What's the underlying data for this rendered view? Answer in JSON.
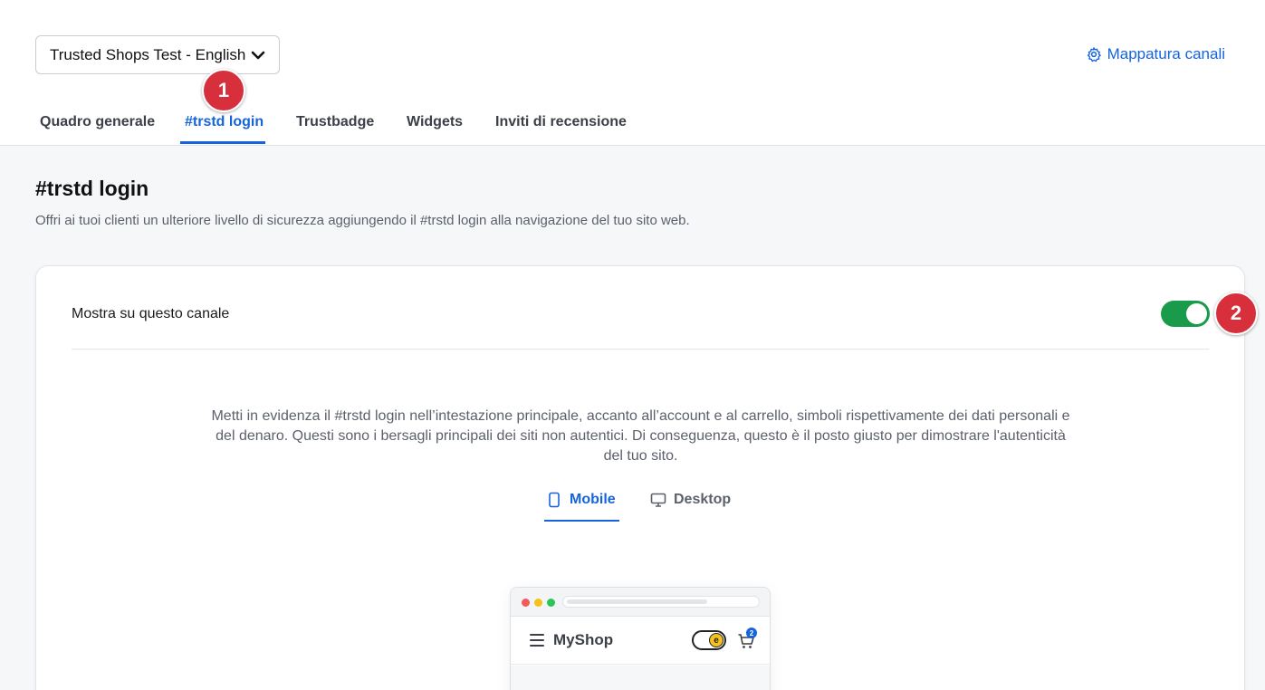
{
  "header": {
    "channel_select": "Trusted Shops Test - English",
    "mapping_link": "Mappatura canali"
  },
  "tabs": [
    {
      "label": "Quadro generale"
    },
    {
      "label": "#trstd login"
    },
    {
      "label": "Trustbadge"
    },
    {
      "label": "Widgets"
    },
    {
      "label": "Inviti di recensione"
    }
  ],
  "active_tab": "#trstd login",
  "badges": {
    "one": "1",
    "two": "2"
  },
  "page": {
    "title": "#trstd login",
    "subtitle": "Offri ai tuoi clienti un ulteriore livello di sicurezza aggiungendo il #trstd login alla navigazione del tuo sito web."
  },
  "card": {
    "show_label": "Mostra su questo canale",
    "show_enabled": true,
    "description": "Metti in evidenza il #trstd login nell’intestazione principale, accanto all’account e al carrello, simboli rispettivamente dei dati personali e del denaro. Questi sono i bersagli principali dei siti non autentici. Di conseguenza, questo è il posto giusto per dimostrare l'autenticità del tuo sito.",
    "view_tabs": [
      {
        "label": "Mobile",
        "icon": "mobile-icon"
      },
      {
        "label": "Desktop",
        "icon": "desktop-icon"
      }
    ],
    "active_view": "Mobile"
  },
  "preview": {
    "shop_name": "MyShop",
    "cart_count": "2"
  },
  "colors": {
    "accent": "#1664dc",
    "toggle_on": "#1a9b4b",
    "badge": "#d72f3b"
  }
}
